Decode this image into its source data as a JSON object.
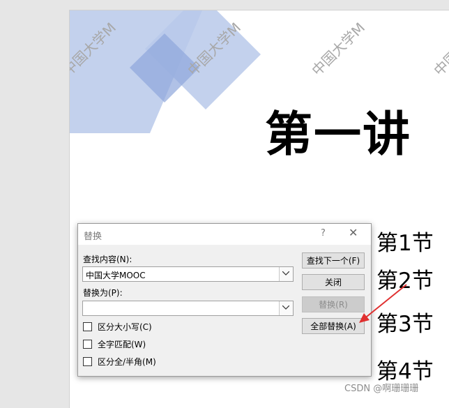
{
  "slide": {
    "watermark_text": "中国大学M",
    "title": "第一讲",
    "sections": [
      "第1节 ",
      "第2节 ",
      "第3节 ",
      "第4节 "
    ],
    "deco_color": "#a8bde6"
  },
  "dialog": {
    "title": "替换",
    "help": "?",
    "close": "✕",
    "find_label": "查找内容(N):",
    "find_value": "中国大学MOOC",
    "replace_label": "替换为(P):",
    "replace_value": "",
    "options": [
      {
        "label": "区分大小写(C)",
        "checked": false
      },
      {
        "label": "全字匹配(W)",
        "checked": false
      },
      {
        "label": "区分全/半角(M)",
        "checked": false
      }
    ],
    "buttons": {
      "find_next": "查找下一个(F)",
      "close": "关闭",
      "replace": "替换(R)",
      "replace_all": "全部替换(A)"
    }
  },
  "annotation_color": "#e03030",
  "credit": "CSDN @啊珊珊珊"
}
